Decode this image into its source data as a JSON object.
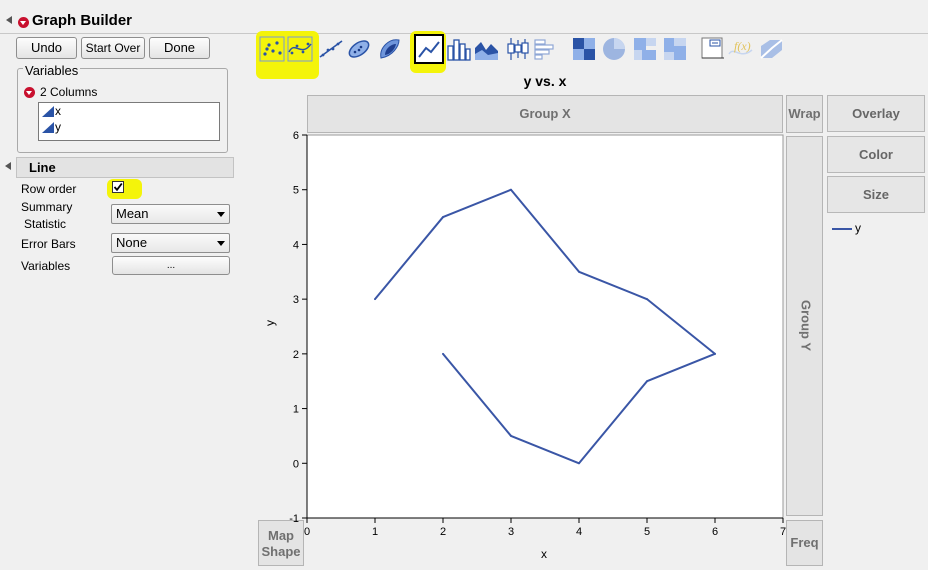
{
  "window": {
    "title": "Graph Builder"
  },
  "toolbar": {
    "undo": "Undo",
    "start_over": "Start Over",
    "done": "Done"
  },
  "variables_panel": {
    "title": "Variables",
    "columns_label": "2 Columns",
    "columns": [
      "x",
      "y"
    ]
  },
  "line_section": {
    "title": "Line",
    "row_order_label": "Row order",
    "row_order_checked": true,
    "summary_label_1": "Summary",
    "summary_label_2": "Statistic",
    "summary_value": "Mean",
    "error_bars_label": "Error Bars",
    "error_bars_value": "None",
    "variables_label": "Variables",
    "variables_button": "..."
  },
  "element_icons": [
    "points-icon",
    "smoother-icon",
    "line-of-fit-icon",
    "ellipse-icon",
    "contour-icon",
    "line-icon",
    "bar-icon",
    "area-icon",
    "box-plot-icon",
    "histogram-icon",
    "heatmap-icon",
    "pie-icon",
    "treemap-icon",
    "mosaic-icon",
    "caption-box-icon",
    "formula-icon",
    "map-shapes-icon"
  ],
  "graph": {
    "title": "y vs. x",
    "group_x": "Group X",
    "group_y": "Group Y",
    "wrap": "Wrap",
    "overlay": "Overlay",
    "color": "Color",
    "size": "Size",
    "freq": "Freq",
    "map_shape_1": "Map",
    "map_shape_2": "Shape",
    "legend_label": "y",
    "line_color": "#3a56a6"
  },
  "chart_data": {
    "type": "line",
    "title": "y vs. x",
    "xlabel": "x",
    "ylabel": "y",
    "xlim": [
      0,
      7
    ],
    "ylim": [
      -1,
      6
    ],
    "xticks": [
      0,
      1,
      2,
      3,
      4,
      5,
      6,
      7
    ],
    "yticks": [
      -1,
      0,
      1,
      2,
      3,
      4,
      5,
      6
    ],
    "grid": false,
    "legend": "right",
    "series": [
      {
        "name": "y",
        "x": [
          1,
          2,
          3,
          4,
          5,
          6,
          5,
          4,
          3,
          2
        ],
        "y": [
          3,
          4.5,
          5,
          3.5,
          3,
          2,
          1.5,
          0,
          0.5,
          2
        ]
      }
    ]
  }
}
